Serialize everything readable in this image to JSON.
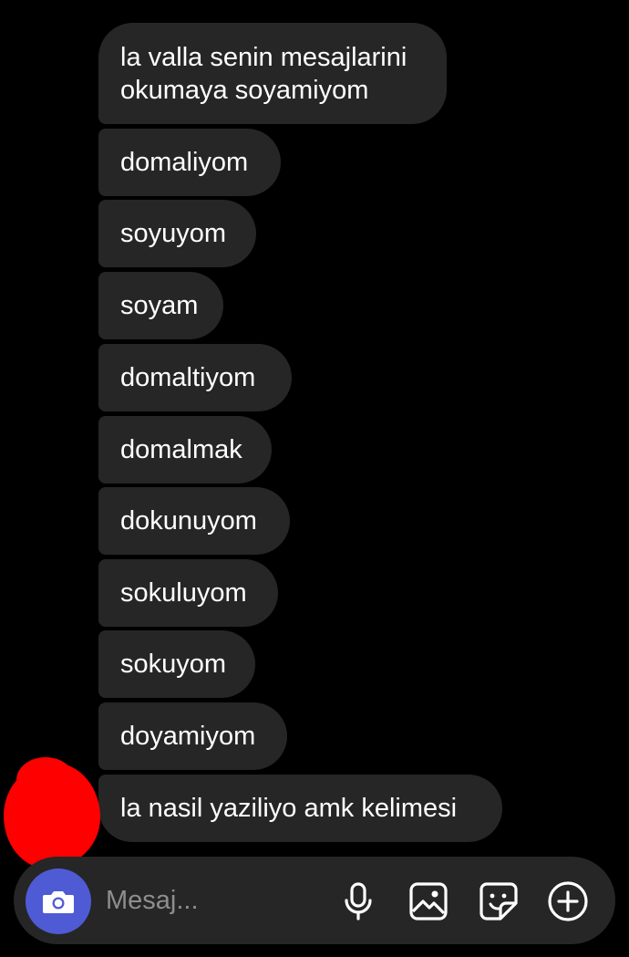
{
  "messages": [
    {
      "text": "la valla senin mesajlarini\nokumaya soyamiyom"
    },
    {
      "text": "domaliyom"
    },
    {
      "text": "soyuyom"
    },
    {
      "text": "soyam"
    },
    {
      "text": "domaltiyom"
    },
    {
      "text": "domalmak"
    },
    {
      "text": "dokunuyom"
    },
    {
      "text": "sokuluyom"
    },
    {
      "text": "sokuyom"
    },
    {
      "text": "doyamiyom"
    },
    {
      "text": "la nasil yaziliyo amk kelimesi"
    }
  ],
  "composer": {
    "placeholder": "Mesaj...",
    "buttons": [
      "camera-icon",
      "microphone-icon",
      "gallery-icon",
      "sticker-icon",
      "plus-icon"
    ],
    "accent_color": "#4f5bd5"
  },
  "colors": {
    "background": "#000000",
    "bubble": "#262626",
    "avatar_redaction": "#ff0000"
  }
}
